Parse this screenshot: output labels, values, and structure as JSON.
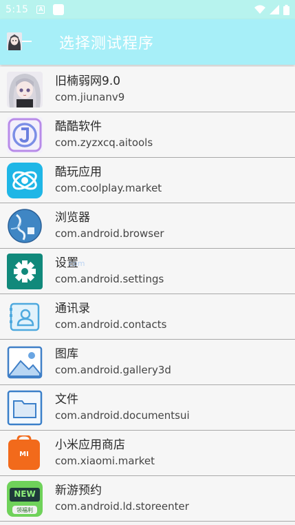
{
  "status": {
    "time": "5:15",
    "notification_icon": "a-icon",
    "app_icon": "square-icon",
    "right_icons": [
      "wifi-icon",
      "signal-icon",
      "battery-icon"
    ]
  },
  "app_bar": {
    "title": "选择测试程序",
    "avatar_icon": "avatar-icon",
    "back_icon": "back-arrow-icon"
  },
  "watermark": "com",
  "apps": [
    {
      "name": "旧楠弱网9.0",
      "package": "com.jiunanv9",
      "icon": "anime-avatar-icon"
    },
    {
      "name": "酷酷软件",
      "package": "com.zyzxcq.aitools",
      "icon": "j-logo-icon"
    },
    {
      "name": "酷玩应用",
      "package": "com.coolplay.market",
      "icon": "coolplay-icon"
    },
    {
      "name": "浏览器",
      "package": "com.android.browser",
      "icon": "globe-icon"
    },
    {
      "name": "设置",
      "package": "com.android.settings",
      "icon": "gear-icon"
    },
    {
      "name": "通讯录",
      "package": "com.android.contacts",
      "icon": "contacts-icon"
    },
    {
      "name": "图库",
      "package": "com.android.gallery3d",
      "icon": "gallery-icon"
    },
    {
      "name": "文件",
      "package": "com.android.documentsui",
      "icon": "folder-icon"
    },
    {
      "name": "小米应用商店",
      "package": "com.xiaomi.market",
      "icon": "mi-store-icon",
      "icon_text": "MI"
    },
    {
      "name": "新游预约",
      "package": "com.android.ld.storeenter",
      "icon": "new-game-icon",
      "icon_text": "NEW",
      "icon_subtext": "领福利"
    }
  ]
}
